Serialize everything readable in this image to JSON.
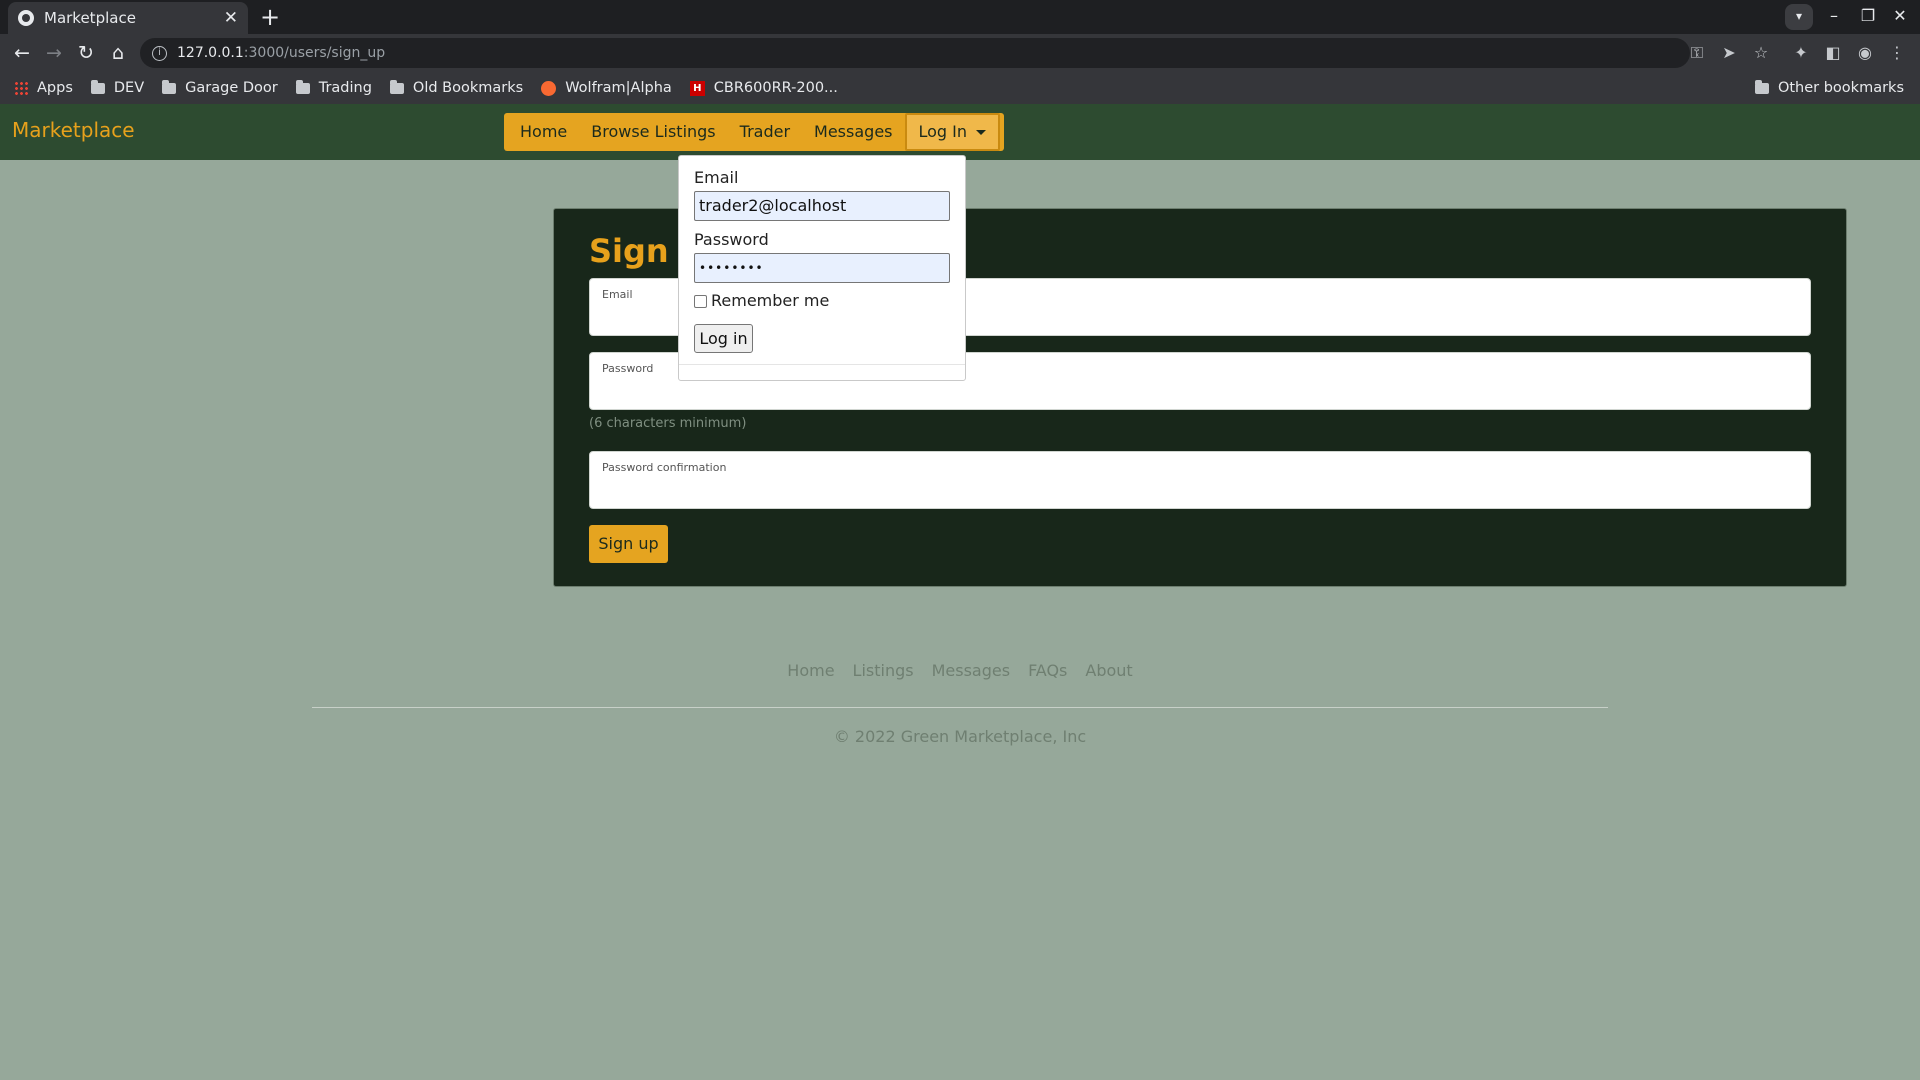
{
  "browser": {
    "tab_title": "Marketplace",
    "tab_close": "✕",
    "new_tab": "+",
    "url_host": "127.0.0.1",
    "url_path": ":3000/users/sign_up",
    "bookmarks": [
      "Apps",
      "DEV",
      "Garage Door",
      "Trading",
      "Old Bookmarks",
      "Wolfram|Alpha",
      "CBR600RR-200..."
    ],
    "other_bookmarks": "Other bookmarks"
  },
  "navbar": {
    "brand": "Marketplace",
    "items": [
      "Home",
      "Browse Listings",
      "Trader",
      "Messages"
    ],
    "login_label": "Log In"
  },
  "signup": {
    "title": "Sign up",
    "email_label": "Email",
    "password_label": "Password",
    "password_hint": "(6 characters minimum)",
    "confirm_label": "Password confirmation",
    "submit_label": "Sign up"
  },
  "login_dropdown": {
    "email_label": "Email",
    "email_value": "trader2@localhost",
    "password_label": "Password",
    "password_value": "••••••••",
    "remember_label": "Remember me",
    "submit_label": "Log in"
  },
  "footer": {
    "links": [
      "Home",
      "Listings",
      "Messages",
      "FAQs",
      "About"
    ],
    "copyright": "© 2022 Green Marketplace, Inc"
  },
  "colors": {
    "page_bg": "#96a89a",
    "navbar_bg": "#2d4b30",
    "accent": "#e5a420",
    "card_bg": "#18271a"
  }
}
